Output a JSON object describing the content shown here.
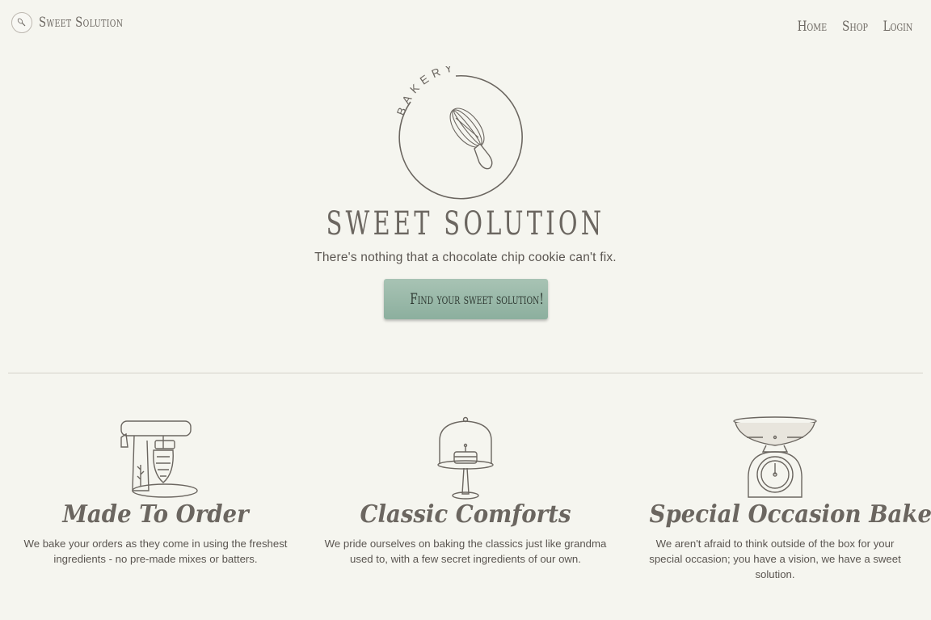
{
  "nav": {
    "brand": "Sweet Solution",
    "links": [
      "Home",
      "Shop",
      "Login"
    ]
  },
  "hero": {
    "logo_text": "BAKERY",
    "title": "SWEET SOLUTION",
    "tagline": "There's nothing that a chocolate chip cookie can't fix.",
    "cta": "Find your sweet solution!"
  },
  "features": [
    {
      "icon": "stand-mixer-icon",
      "title": "Made To Order",
      "text": "We bake your orders as they come in using the freshest ingredients - no pre-made mixes or batters."
    },
    {
      "icon": "cake-stand-icon",
      "title": "Classic Comforts",
      "text": "We pride ourselves on baking the classics just like grandma used to, with a few secret ingredients of our own."
    },
    {
      "icon": "kitchen-scale-icon",
      "title": "Special Occasion Bakes",
      "text": "We aren't afraid to think outside of the box for your special occasion; you have a vision, we have a sweet solution."
    }
  ],
  "colors": {
    "background": "#f5f5ef",
    "button": "#9bbaa9",
    "text": "#5a5550"
  }
}
